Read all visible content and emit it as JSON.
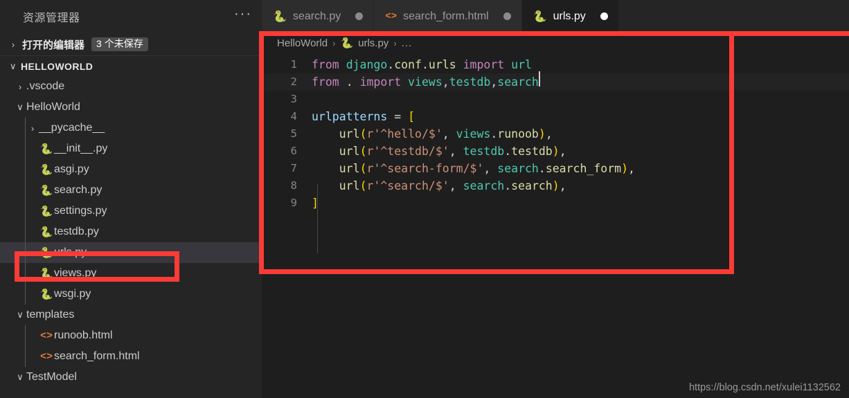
{
  "sidebar": {
    "title": "资源管理器",
    "more_label": "···",
    "open_editors": {
      "label": "打开的编辑器",
      "badge": "3 个未保存",
      "chevron": "›"
    },
    "root": {
      "label": "HELLOWORLD",
      "chevron": "∨"
    },
    "items": [
      {
        "name": ".vscode",
        "kind": "folder",
        "indent": 1,
        "twisty": "›",
        "expanded": false
      },
      {
        "name": "HelloWorld",
        "kind": "folder",
        "indent": 1,
        "twisty": "∨",
        "expanded": true
      },
      {
        "name": "__pycache__",
        "kind": "folder",
        "indent": 2,
        "twisty": "›",
        "expanded": false
      },
      {
        "name": "__init__.py",
        "kind": "python",
        "indent": 2,
        "twisty": ""
      },
      {
        "name": "asgi.py",
        "kind": "python",
        "indent": 2,
        "twisty": ""
      },
      {
        "name": "search.py",
        "kind": "python",
        "indent": 2,
        "twisty": ""
      },
      {
        "name": "settings.py",
        "kind": "python",
        "indent": 2,
        "twisty": ""
      },
      {
        "name": "testdb.py",
        "kind": "python",
        "indent": 2,
        "twisty": ""
      },
      {
        "name": "urls.py",
        "kind": "python",
        "indent": 2,
        "twisty": "",
        "selected": true
      },
      {
        "name": "views.py",
        "kind": "python",
        "indent": 2,
        "twisty": ""
      },
      {
        "name": "wsgi.py",
        "kind": "python",
        "indent": 2,
        "twisty": ""
      },
      {
        "name": "templates",
        "kind": "folder",
        "indent": 1,
        "twisty": "∨",
        "expanded": true
      },
      {
        "name": "runoob.html",
        "kind": "html",
        "indent": 2,
        "twisty": ""
      },
      {
        "name": "search_form.html",
        "kind": "html",
        "indent": 2,
        "twisty": ""
      },
      {
        "name": "TestModel",
        "kind": "folder",
        "indent": 1,
        "twisty": "∨",
        "expanded": true
      }
    ]
  },
  "tabs": [
    {
      "label": "search.py",
      "icon": "python-icon",
      "dirty": true,
      "active": false
    },
    {
      "label": "search_form.html",
      "icon": "html-icon",
      "dirty": true,
      "active": false
    },
    {
      "label": "urls.py",
      "icon": "python-icon",
      "dirty": true,
      "active": true
    }
  ],
  "breadcrumb": {
    "project": "HelloWorld",
    "sep": "›",
    "file": "urls.py",
    "overflow": "..."
  },
  "editor": {
    "language": "python",
    "filename": "urls.py",
    "cursor_line": 2,
    "lines": [
      {
        "n": "1",
        "text": "from django.conf.urls import url"
      },
      {
        "n": "2",
        "text": "from . import views,testdb,search",
        "current": true
      },
      {
        "n": "3",
        "text": ""
      },
      {
        "n": "4",
        "text": "urlpatterns = ["
      },
      {
        "n": "5",
        "text": "    url(r'^hello/$', views.runoob),"
      },
      {
        "n": "6",
        "text": "    url(r'^testdb/$', testdb.testdb),"
      },
      {
        "n": "7",
        "text": "    url(r'^search-form/$', search.search_form),"
      },
      {
        "n": "8",
        "text": "    url(r'^search/$', search.search),"
      },
      {
        "n": "9",
        "text": "]"
      }
    ]
  },
  "watermark": "https://blog.csdn.net/xulei1132562",
  "annotations": {
    "accent_red": "#fb3b36",
    "editor_box_label": "urls.py code region highlight",
    "sidebar_box_label": "urls.py file highlight"
  }
}
